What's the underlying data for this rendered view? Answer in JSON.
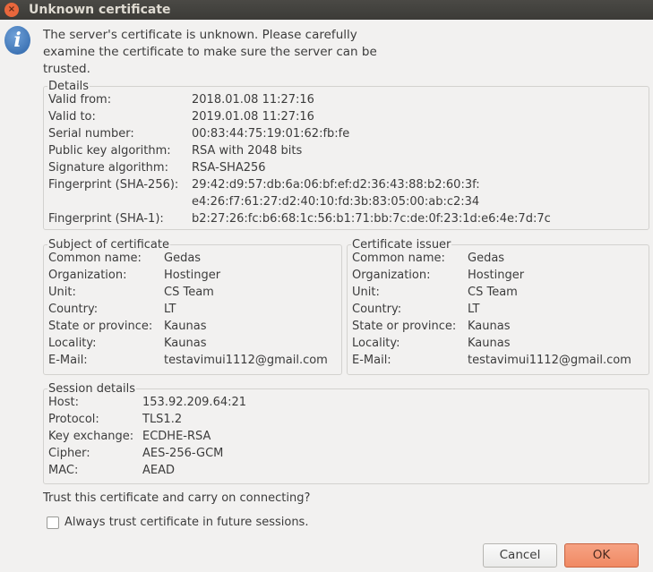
{
  "window": {
    "title": "Unknown certificate"
  },
  "message": "The server's certificate is unknown. Please carefully examine the certificate to make sure the server can be trusted.",
  "details": {
    "legend": "Details",
    "rows": [
      {
        "label": "Valid from:",
        "value": "2018.01.08 11:27:16"
      },
      {
        "label": "Valid to:",
        "value": "2019.01.08 11:27:16"
      },
      {
        "label": "Serial number:",
        "value": "00:83:44:75:19:01:62:fb:fe"
      },
      {
        "label": "Public key algorithm:",
        "value": "RSA with 2048 bits"
      },
      {
        "label": "Signature algorithm:",
        "value": "RSA-SHA256"
      },
      {
        "label": "Fingerprint (SHA-256):",
        "value": "29:42:d9:57:db:6a:06:bf:ef:d2:36:43:88:b2:60:3f:",
        "value2": "e4:26:f7:61:27:d2:40:10:fd:3b:83:05:00:ab:c2:34"
      },
      {
        "label": "Fingerprint (SHA-1):",
        "value": "b2:27:26:fc:b6:68:1c:56:b1:71:bb:7c:de:0f:23:1d:e6:4e:7d:7c"
      }
    ]
  },
  "subject": {
    "legend": "Subject of certificate",
    "rows": [
      {
        "label": "Common name:",
        "value": "Gedas"
      },
      {
        "label": "Organization:",
        "value": "Hostinger"
      },
      {
        "label": "Unit:",
        "value": "CS Team"
      },
      {
        "label": "Country:",
        "value": "LT"
      },
      {
        "label": "State or province:",
        "value": "Kaunas"
      },
      {
        "label": "Locality:",
        "value": "Kaunas"
      },
      {
        "label": "E-Mail:",
        "value": "testavimui1112@gmail.com"
      }
    ]
  },
  "issuer": {
    "legend": "Certificate issuer",
    "rows": [
      {
        "label": "Common name:",
        "value": "Gedas"
      },
      {
        "label": "Organization:",
        "value": "Hostinger"
      },
      {
        "label": "Unit:",
        "value": "CS Team"
      },
      {
        "label": "Country:",
        "value": "LT"
      },
      {
        "label": "State or province:",
        "value": "Kaunas"
      },
      {
        "label": "Locality:",
        "value": "Kaunas"
      },
      {
        "label": "E-Mail:",
        "value": "testavimui1112@gmail.com"
      }
    ]
  },
  "session": {
    "legend": "Session details",
    "rows": [
      {
        "label": "Host:",
        "value": "153.92.209.64:21"
      },
      {
        "label": "Protocol:",
        "value": "TLS1.2"
      },
      {
        "label": "Key exchange:",
        "value": "ECDHE-RSA"
      },
      {
        "label": "Cipher:",
        "value": "AES-256-GCM"
      },
      {
        "label": "MAC:",
        "value": "AEAD"
      }
    ]
  },
  "question": "Trust this certificate and carry on connecting?",
  "always_trust": {
    "label": "Always trust certificate in future sessions.",
    "checked": false
  },
  "buttons": {
    "cancel": "Cancel",
    "ok": "OK"
  }
}
